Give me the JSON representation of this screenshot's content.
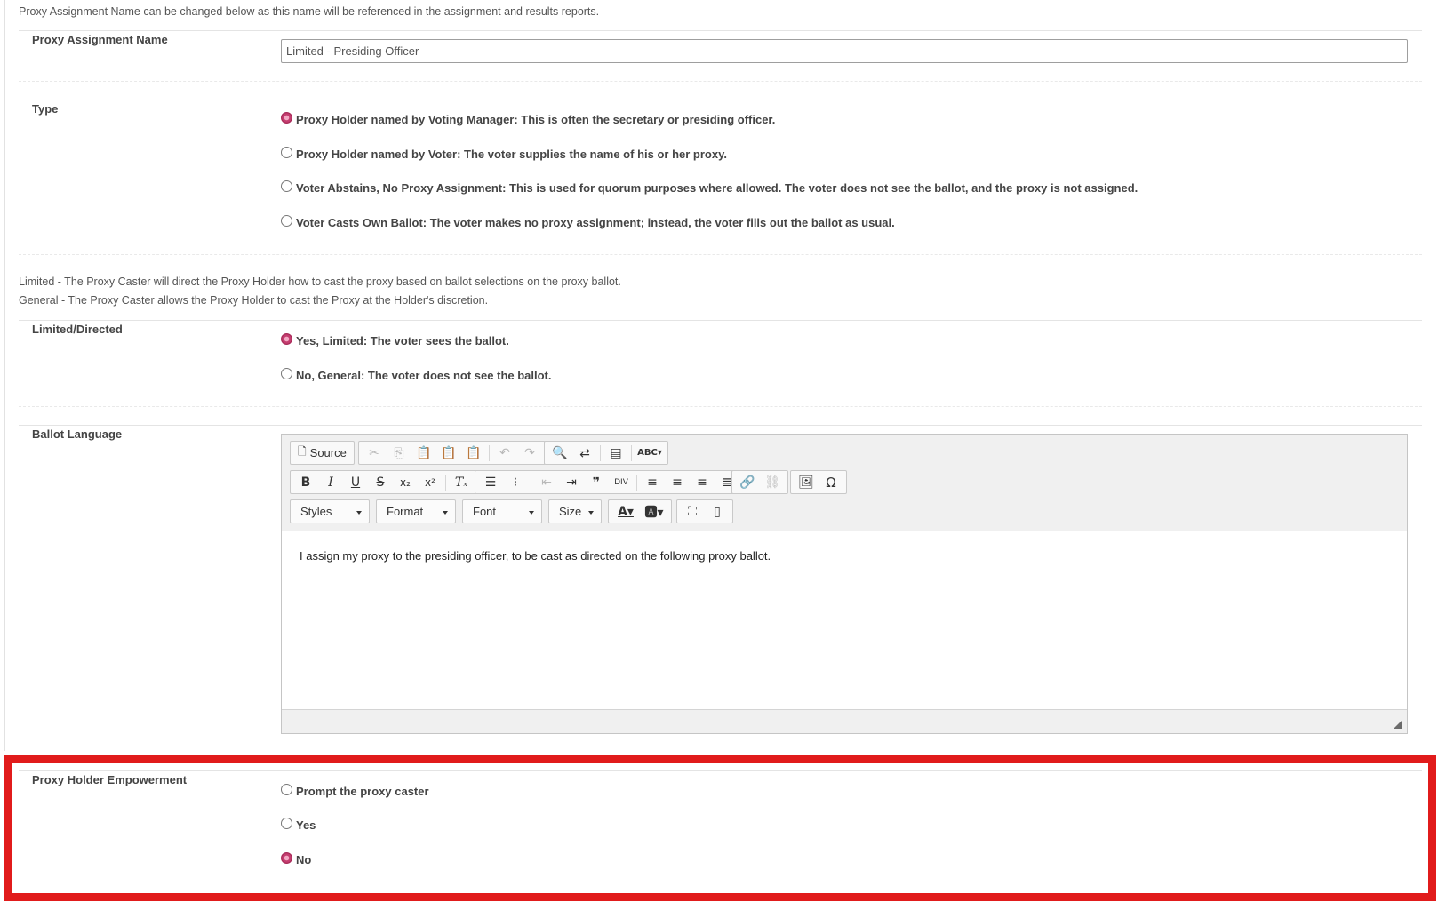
{
  "intro_note": "Proxy Assignment Name can be changed below as this name will be referenced in the assignment and results reports.",
  "name_section": {
    "label": "Proxy Assignment Name",
    "value": "Limited - Presiding Officer"
  },
  "type_section": {
    "label": "Type",
    "options": [
      {
        "text": "Proxy Holder named by Voting Manager: This is often the secretary or presiding officer.",
        "checked": true
      },
      {
        "text": "Proxy Holder named by Voter: The voter supplies the name of his or her proxy.",
        "checked": false
      },
      {
        "text": "Voter Abstains, No Proxy Assignment: This is used for quorum purposes where allowed. The voter does not see the ballot, and the proxy is not assigned.",
        "checked": false
      },
      {
        "text": "Voter Casts Own Ballot: The voter makes no proxy assignment; instead, the voter fills out the ballot as usual.",
        "checked": false
      }
    ]
  },
  "limited_notes": [
    "Limited - The Proxy Caster will direct the Proxy Holder how to cast the proxy based on ballot selections on the proxy ballot.",
    "General - The Proxy Caster allows the Proxy Holder to cast the Proxy at the Holder's discretion."
  ],
  "limited_section": {
    "label": "Limited/Directed",
    "options": [
      {
        "text": "Yes, Limited: The voter sees the ballot.",
        "checked": true
      },
      {
        "text": "No, General: The voter does not see the ballot.",
        "checked": false
      }
    ]
  },
  "ballot_section": {
    "label": "Ballot Language",
    "toolbar": {
      "source_label": "Source",
      "styles_label": "Styles",
      "format_label": "Format",
      "font_label": "Font",
      "size_label": "Size"
    },
    "content": "I assign my proxy to the presiding officer, to be cast as directed on the following proxy ballot."
  },
  "empowerment_section": {
    "label": "Proxy Holder Empowerment",
    "options": [
      {
        "text": "Prompt the proxy caster",
        "checked": false
      },
      {
        "text": "Yes",
        "checked": false
      },
      {
        "text": "No",
        "checked": true
      }
    ]
  },
  "colors": {
    "radio_checked": "#a82a58",
    "highlight_border": "#e11b1b",
    "label_text": "#444444"
  }
}
